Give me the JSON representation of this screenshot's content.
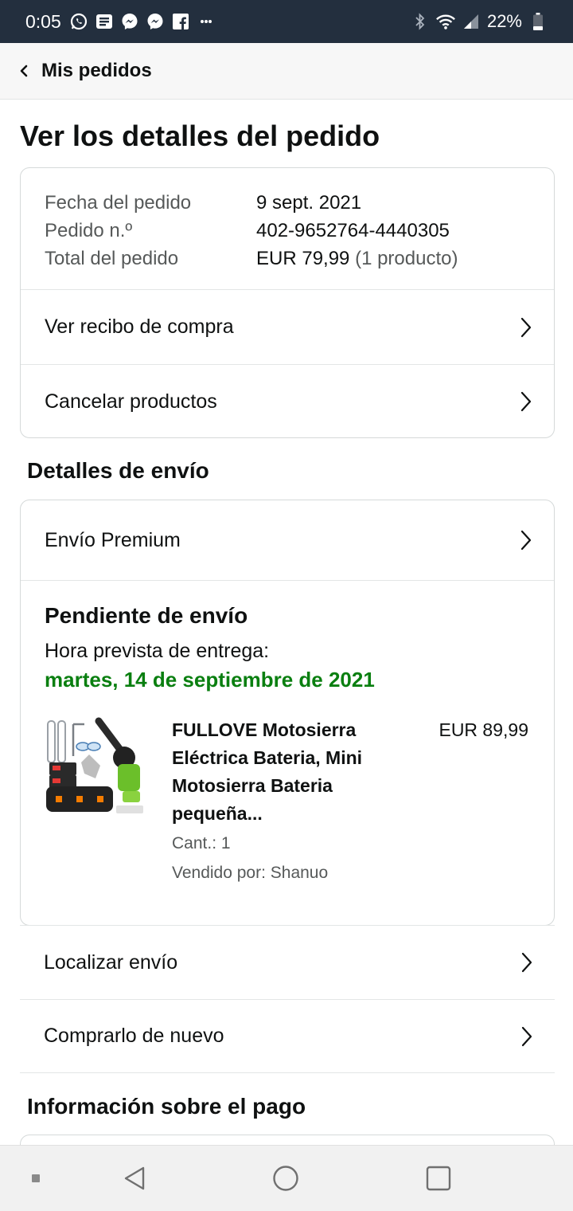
{
  "status_bar": {
    "time": "0:05",
    "battery": "22%",
    "left_icons": [
      "whatsapp-icon",
      "news-icon",
      "messenger-icon",
      "messenger-icon",
      "facebook-icon",
      "more-icon"
    ],
    "right_icons": [
      "bluetooth-icon",
      "wifi-icon",
      "signal-icon",
      "battery-icon"
    ]
  },
  "nav": {
    "back_label": "Mis pedidos"
  },
  "page_title": "Ver los detalles del pedido",
  "summary": {
    "rows": [
      {
        "label": "Fecha del pedido",
        "value": "9 sept. 2021"
      },
      {
        "label": "Pedido n.º",
        "value": "402-9652764-4440305"
      }
    ],
    "total_label": "Total del pedido",
    "total_value": "EUR 79,99",
    "total_items": "(1 producto)",
    "links": [
      "Ver recibo de compra",
      "Cancelar productos"
    ]
  },
  "shipping": {
    "section_title": "Detalles de envío",
    "method": "Envío Premium",
    "status": "Pendiente de envío",
    "eta_label": "Hora prevista de entrega:",
    "eta_date": "martes, 14 de septiembre de 2021",
    "product": {
      "title": "FULLOVE Motosierra Eléctrica Bateria, Mini Motosierra Bateria pequeña...",
      "price": "EUR 89,99",
      "quantity": "Cant.: 1",
      "seller": "Vendido por: Shanuo"
    }
  },
  "actions": [
    "Localizar envío",
    "Comprarlo de nuevo"
  ],
  "payment": {
    "section_title": "Información sobre el pago"
  },
  "colors": {
    "status_bar": "#232f3e",
    "eta_green": "#0a7f10",
    "text": "#0f1111",
    "muted": "#565959"
  }
}
